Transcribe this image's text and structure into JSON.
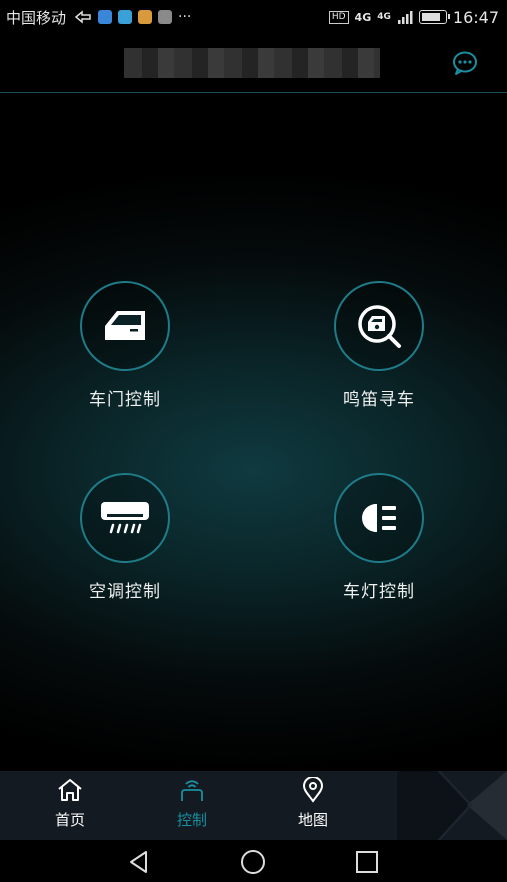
{
  "status_bar": {
    "carrier": "中国移动",
    "more": "···",
    "hd": "HD",
    "network_1": "4G",
    "network_2": "4G",
    "time": "16:47"
  },
  "header": {
    "title": "",
    "chat_icon": "chat-bubble-icon"
  },
  "controls": [
    {
      "label": "车门控制",
      "icon": "car-door-icon"
    },
    {
      "label": "鸣笛寻车",
      "icon": "find-car-icon"
    },
    {
      "label": "空调控制",
      "icon": "air-conditioner-icon"
    },
    {
      "label": "车灯控制",
      "icon": "headlight-icon"
    }
  ],
  "tabbar": {
    "tabs": [
      {
        "label": "首页",
        "icon": "home-icon",
        "active": false
      },
      {
        "label": "控制",
        "icon": "control-icon",
        "active": true
      },
      {
        "label": "地图",
        "icon": "map-pin-icon",
        "active": false
      }
    ],
    "active_color": "#1a8fa0",
    "inactive_color": "#ffffff"
  },
  "navbar": {
    "back": "back-icon",
    "home": "home-circle-icon",
    "recents": "recents-icon"
  },
  "colors": {
    "accent": "#1e7b87",
    "background": "#000000"
  }
}
